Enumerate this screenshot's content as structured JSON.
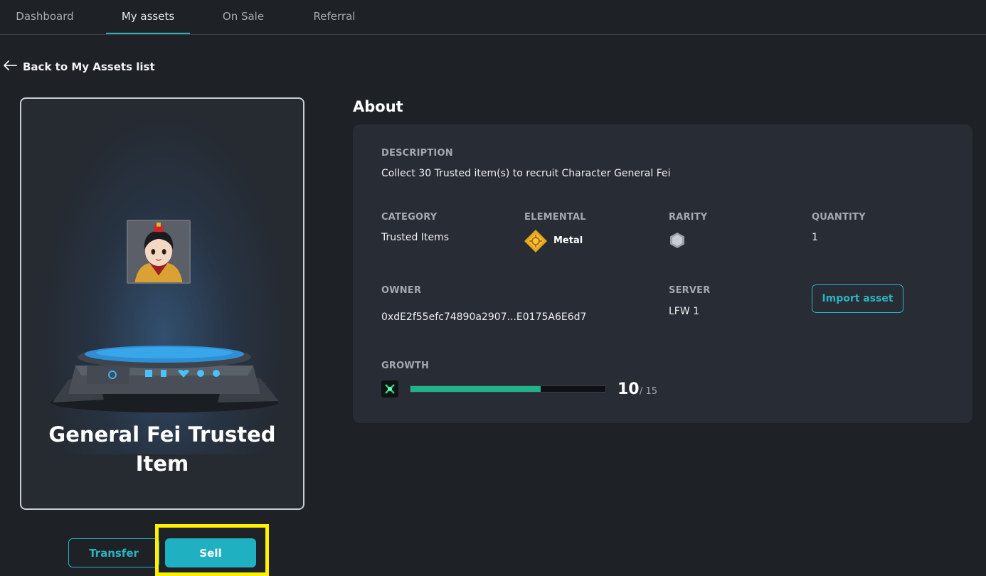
{
  "nav": {
    "tabs": [
      {
        "label": "Dashboard",
        "active": false
      },
      {
        "label": "My assets",
        "active": true
      },
      {
        "label": "On Sale",
        "active": false
      },
      {
        "label": "Referral",
        "active": false
      }
    ]
  },
  "back_link": {
    "label": "Back to My Assets list",
    "icon": "arrow-left-icon"
  },
  "card": {
    "title": "General Fei Trusted Item",
    "portrait_icon": "general-fei-portrait"
  },
  "actions": {
    "transfer_label": "Transfer",
    "sell_label": "Sell"
  },
  "about": {
    "title": "About",
    "description_label": "DESCRIPTION",
    "description": "Collect 30 Trusted item(s) to recruit Character General Fei",
    "category_label": "CATEGORY",
    "category": "Trusted Items",
    "elemental_label": "ELEMENTAL",
    "elemental": "Metal",
    "rarity_label": "RARITY",
    "quantity_label": "QUANTITY",
    "quantity": "1",
    "owner_label": "OWNER",
    "owner": "0xdE2f55efc74890a2907...E0175A6E6d7",
    "server_label": "SERVER",
    "server": "LFW 1",
    "import_label": "Import asset",
    "growth_label": "GROWTH",
    "growth_current": "10",
    "growth_max": "/ 15",
    "growth_fraction": 0.667
  },
  "colors": {
    "accent": "#2bb3c0",
    "sell_bg": "#1fb0c2",
    "growth_bar": "#1fb387",
    "highlight": "#fff100"
  }
}
